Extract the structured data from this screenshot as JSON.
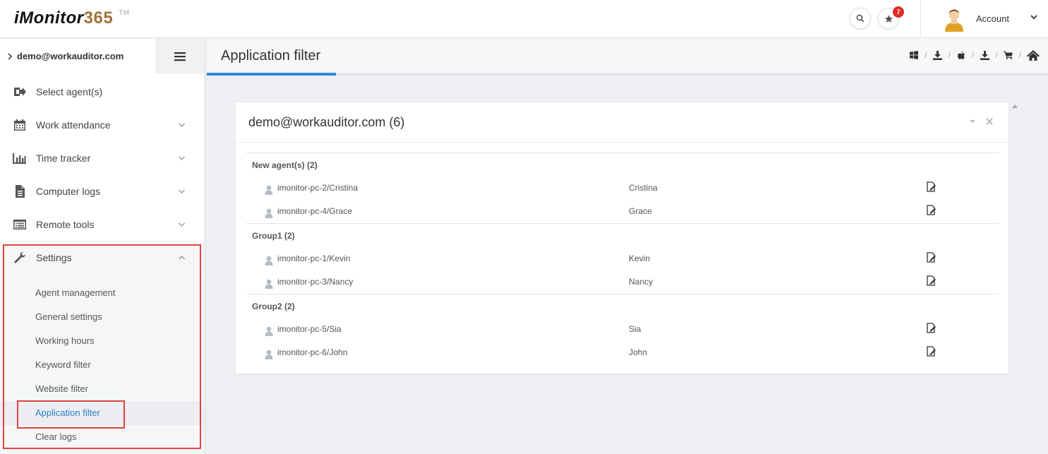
{
  "header": {
    "logo_text": "iMonitor",
    "logo_number": "365",
    "logo_tm": "TM",
    "notification_count": "7",
    "account_label": "Account"
  },
  "sidebar": {
    "user": "demo@workauditor.com",
    "items": [
      {
        "label": "Select agent(s)",
        "icon": "sign-in-icon"
      },
      {
        "label": "Work attendance",
        "icon": "calendar-icon"
      },
      {
        "label": "Time tracker",
        "icon": "bar-chart-icon"
      },
      {
        "label": "Computer logs",
        "icon": "document-icon"
      },
      {
        "label": "Remote tools",
        "icon": "list-icon"
      },
      {
        "label": "Settings",
        "icon": "wrench-icon"
      }
    ],
    "settings_sub": [
      {
        "label": "Agent management"
      },
      {
        "label": "General settings"
      },
      {
        "label": "Working hours"
      },
      {
        "label": "Keyword filter"
      },
      {
        "label": "Website filter"
      },
      {
        "label": "Application filter",
        "active": true
      },
      {
        "label": "Clear logs"
      }
    ]
  },
  "page": {
    "title": "Application filter"
  },
  "portlet": {
    "title": "demo@workauditor.com (6)",
    "groups": [
      {
        "name": "New agent(s) (2)",
        "agents": [
          {
            "agent": "imonitor-pc-2/Cristina",
            "display": "Cristina"
          },
          {
            "agent": "imonitor-pc-4/Grace",
            "display": "Grace"
          }
        ]
      },
      {
        "name": "Group1 (2)",
        "agents": [
          {
            "agent": "imonitor-pc-1/Kevin",
            "display": "Kevin"
          },
          {
            "agent": "imonitor-pc-3/Nancy",
            "display": "Nancy"
          }
        ]
      },
      {
        "name": "Group2 (2)",
        "agents": [
          {
            "agent": "imonitor-pc-5/Sia",
            "display": "Sia"
          },
          {
            "agent": "imonitor-pc-6/John",
            "display": "John"
          }
        ]
      }
    ]
  },
  "colors": {
    "accent": "#2f8ad6",
    "active_link": "#2f7dc1",
    "highlight": "#e04340",
    "badge": "#e02b27"
  }
}
